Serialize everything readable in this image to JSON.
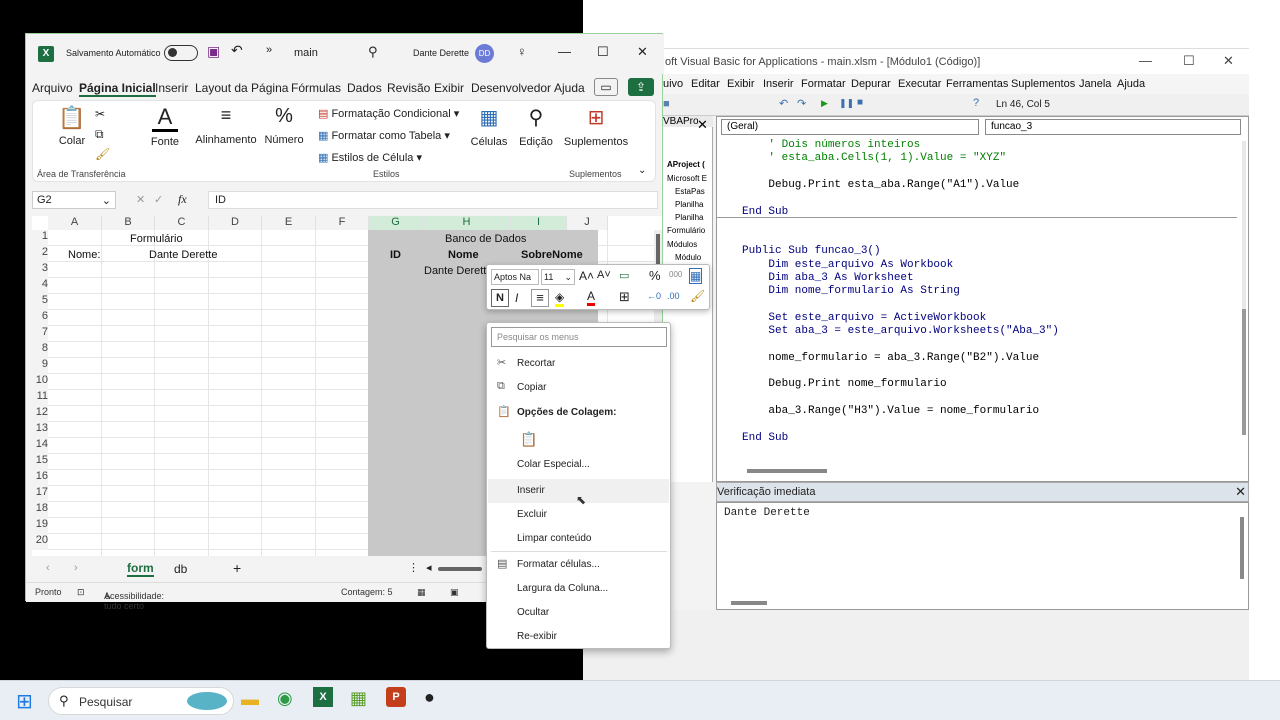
{
  "vba": {
    "title": "oft Visual Basic for Applications - main.xlsm - [Módulo1 (Código)]",
    "menu": [
      "uivo",
      "Editar",
      "Exibir",
      "Inserir",
      "Formatar",
      "Depurar",
      "Executar",
      "Ferramentas",
      "Suplementos",
      "Janela",
      "Ajuda"
    ],
    "position": "Ln 46, Col 5",
    "object_combo": "(Geral)",
    "proc_combo": "funcao_3",
    "project_tab": "VBAPro",
    "project_items": [
      "AProject (",
      "Microsoft E",
      "EstaPas",
      "Planilha",
      "Planilha",
      "Formulário",
      "Módulos",
      "Módulo"
    ],
    "code": [
      {
        "t": "    ' Dois números inteiros",
        "k": "cm"
      },
      {
        "t": "    ' esta_aba.Cells(1, 1).Value = \"XYZ\"",
        "k": "cm"
      },
      {
        "t": "",
        "k": ""
      },
      {
        "t": "    Debug.Print esta_aba.Range(\"A1\").Value",
        "k": ""
      },
      {
        "t": "",
        "k": ""
      },
      {
        "t": "End Sub",
        "k": "kw"
      },
      {
        "t": "",
        "k": ""
      },
      {
        "t": "",
        "k": ""
      },
      {
        "t": "Public Sub funcao_3()",
        "k": "kw"
      },
      {
        "t": "    Dim este_arquivo As Workbook",
        "k": "kw"
      },
      {
        "t": "    Dim aba_3 As Worksheet",
        "k": "kw"
      },
      {
        "t": "    Dim nome_formulario As String",
        "k": "kw"
      },
      {
        "t": "",
        "k": ""
      },
      {
        "t": "    Set este_arquivo = ActiveWorkbook",
        "k": "kw"
      },
      {
        "t": "    Set aba_3 = este_arquivo.Worksheets(\"Aba_3\")",
        "k": "kw"
      },
      {
        "t": "",
        "k": ""
      },
      {
        "t": "    nome_formulario = aba_3.Range(\"B2\").Value",
        "k": ""
      },
      {
        "t": "",
        "k": ""
      },
      {
        "t": "    Debug.Print nome_formulario",
        "k": ""
      },
      {
        "t": "",
        "k": ""
      },
      {
        "t": "    aba_3.Range(\"H3\").Value = nome_formulario",
        "k": ""
      },
      {
        "t": "",
        "k": ""
      },
      {
        "t": "End Sub",
        "k": "kw"
      }
    ],
    "immediate_title": "Verificação imediata",
    "immediate_text": "Dante Derette"
  },
  "excel": {
    "autosave": "Salvamento Automático",
    "filename": "main",
    "user": "Dante Derette",
    "avatar": "DD",
    "menu": [
      "Arquivo",
      "Página Inicial",
      "Inserir",
      "Layout da Página",
      "Fórmulas",
      "Dados",
      "Revisão",
      "Exibir",
      "Desenvolvedor",
      "Ajuda"
    ],
    "ribbon": {
      "colar": "Colar",
      "fonte": "Fonte",
      "alinhamento": "Alinhamento",
      "numero": "Número",
      "formatacao": "Formatação Condicional",
      "tabela": "Formatar como Tabela",
      "estilos_celula": "Estilos de Célula",
      "celulas": "Células",
      "edicao": "Edição",
      "suplementos": "Suplementos",
      "lbl_area": "Área de Transferência",
      "lbl_estilos": "Estilos",
      "lbl_suplementos": "Suplementos"
    },
    "namebox": "G2",
    "formula": "ID",
    "columns": [
      "A",
      "B",
      "C",
      "D",
      "E",
      "F",
      "G",
      "H",
      "I",
      "J"
    ],
    "rows": [
      "1",
      "2",
      "3",
      "4",
      "5",
      "6",
      "7",
      "8",
      "9",
      "10",
      "11",
      "12",
      "13",
      "14",
      "15",
      "16",
      "17",
      "18",
      "19",
      "20"
    ],
    "cells": {
      "formulario": "Formulário",
      "nome_label": "Nome:",
      "nome_value": "Dante Derette",
      "banco": "Banco de Dados",
      "id": "ID",
      "nome": "Nome",
      "sobrenome": "SobreNome",
      "h3": "Dante Derett"
    },
    "sheets": [
      "form",
      "db"
    ],
    "status": {
      "pronto": "Pronto",
      "acess": "Acessibilidade: tudo certo",
      "contagem": "Contagem: 5"
    }
  },
  "mini_toolbar": {
    "font": "Aptos Na",
    "size": "11",
    "bold": "N",
    "italic": "I"
  },
  "context_menu": {
    "search": "Pesquisar os menus",
    "items": [
      "Recortar",
      "Copiar",
      "Opções de Colagem:",
      "Colar Especial...",
      "Inserir",
      "Excluir",
      "Limpar conteúdo",
      "Formatar células...",
      "Largura da Coluna...",
      "Ocultar",
      "Re-exibir"
    ]
  },
  "taskbar": {
    "search": "Pesquisar"
  }
}
